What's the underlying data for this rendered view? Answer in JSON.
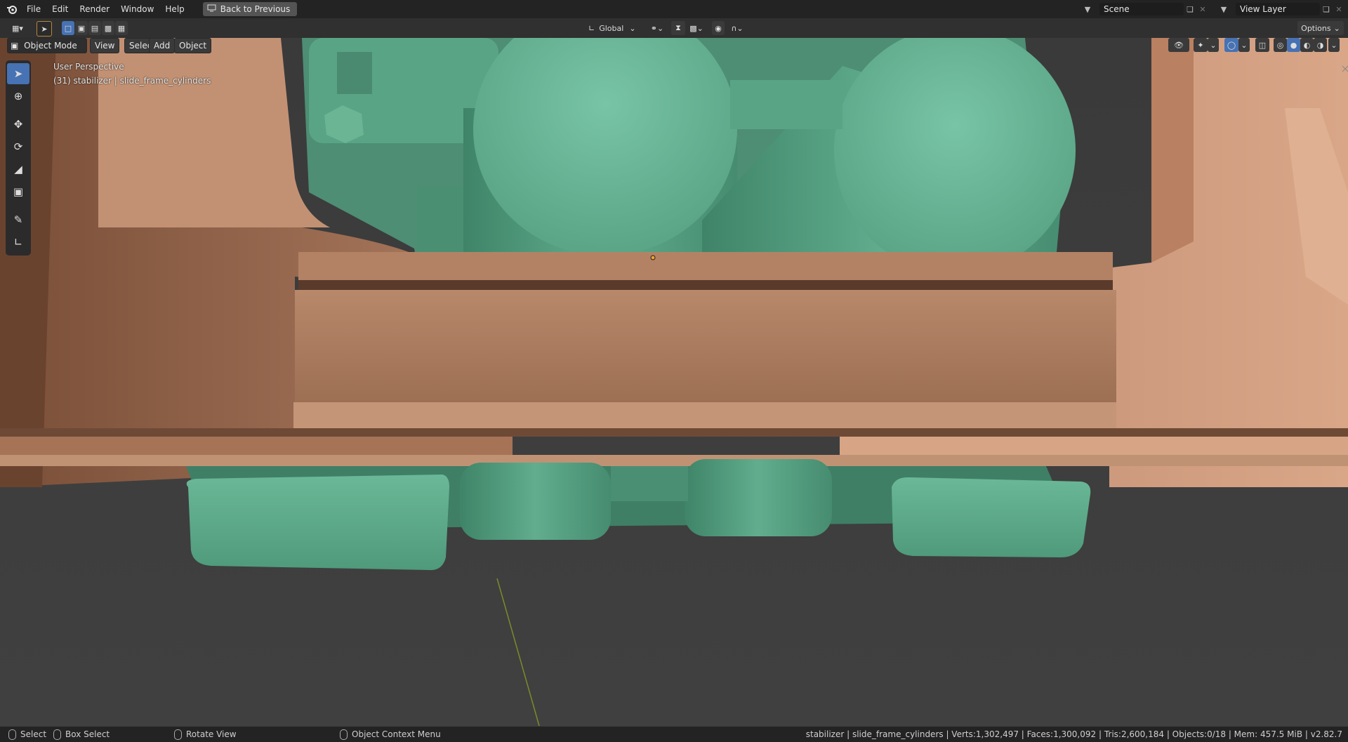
{
  "menu": {
    "items": [
      "File",
      "Edit",
      "Render",
      "Window",
      "Help"
    ],
    "back_button": "Back to Previous"
  },
  "top_right": {
    "scene_label": "Scene",
    "view_layer_label": "View Layer"
  },
  "header": {
    "transform_orientation": "Global",
    "options_label": "Options"
  },
  "viewport_header": {
    "mode": "Object Mode",
    "view": "View",
    "select": "Select",
    "add": "Add",
    "object": "Object"
  },
  "viewport": {
    "perspective": "User Perspective",
    "active_object": "(31) stabilizer | slide_frame_cylinders"
  },
  "tools": [
    "select-box-icon",
    "cursor-icon",
    "move-icon",
    "rotate-icon",
    "scale-icon",
    "transform-icon",
    "annotate-icon",
    "measure-icon"
  ],
  "statusbar": {
    "select": "Select",
    "box_select": "Box Select",
    "rotate_view": "Rotate View",
    "context_menu": "Object Context Menu",
    "stats": "stabilizer | slide_frame_cylinders | Verts:1,302,497 | Faces:1,300,092 | Tris:2,600,184 | Objects:0/18 | Mem: 457.5 MiB | v2.82.7"
  },
  "colors": {
    "frame": "#b98364",
    "cylinders": "#5fae8f",
    "active_tool": "#4772b3",
    "background": "#3d3d3d"
  }
}
